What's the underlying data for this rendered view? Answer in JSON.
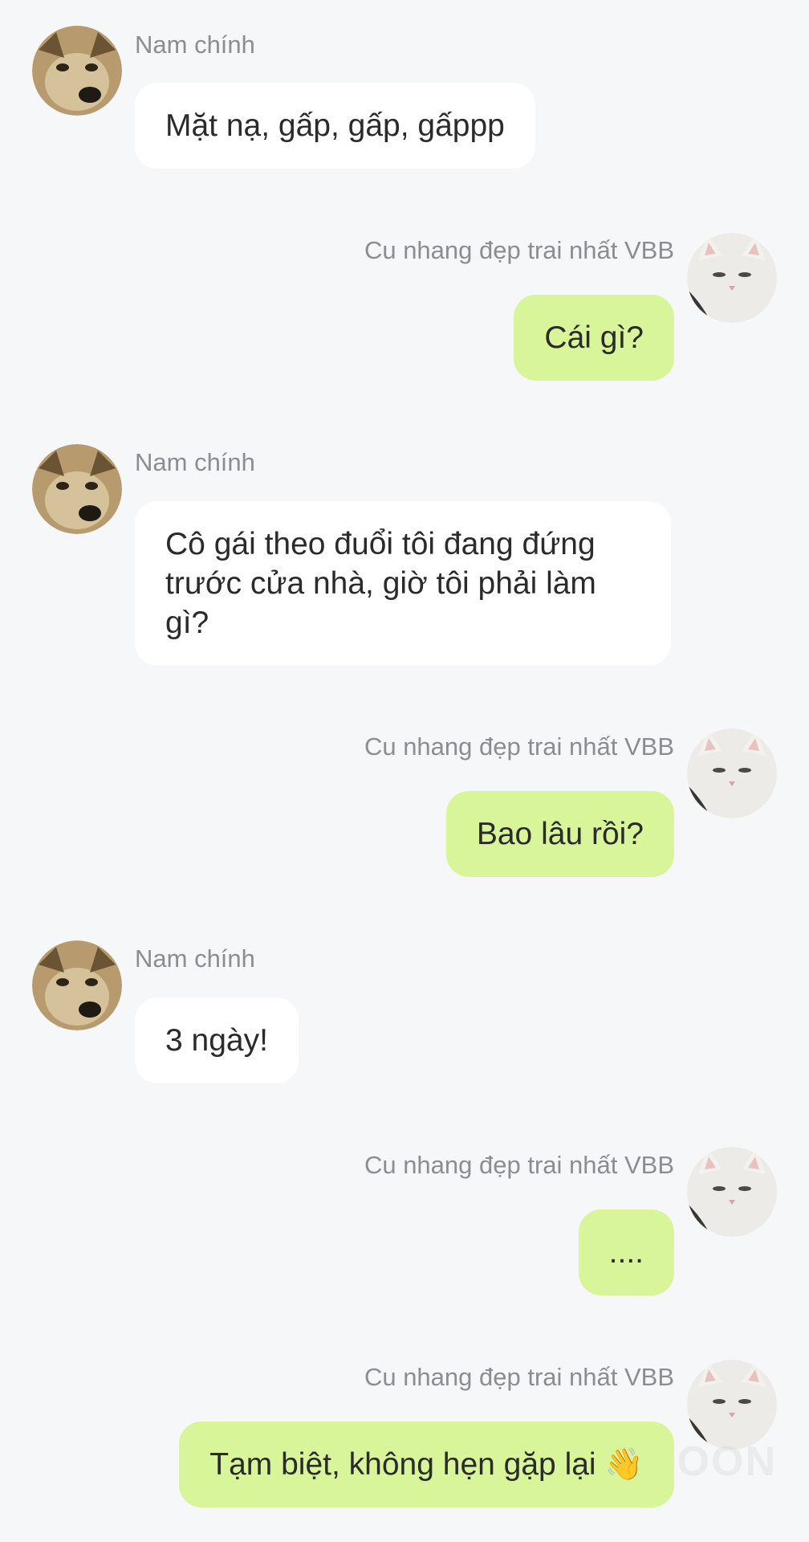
{
  "contacts": {
    "left_name": "Nam chính",
    "right_name": "Cu nhang đẹp trai nhất VBB"
  },
  "messages": [
    {
      "side": "left",
      "sender": "Nam chính",
      "text": "Mặt nạ, gấp, gấp, gấppp"
    },
    {
      "side": "right",
      "sender": "Cu nhang đẹp trai nhất VBB",
      "text": "Cái gì?"
    },
    {
      "side": "left",
      "sender": "Nam chính",
      "text": "Cô gái theo đuổi tôi đang đứng trước cửa nhà, giờ tôi phải làm gì?"
    },
    {
      "side": "right",
      "sender": "Cu nhang đẹp trai nhất VBB",
      "text": "Bao lâu rồi?"
    },
    {
      "side": "left",
      "sender": "Nam chính",
      "text": "3 ngày!"
    },
    {
      "side": "right",
      "sender": "Cu nhang đẹp trai nhất VBB",
      "text": "...."
    },
    {
      "side": "right",
      "sender": "Cu nhang đẹp trai nhất VBB",
      "text": "Tạm biệt, không hẹn gặp lại 👋"
    }
  ],
  "watermark": "OON",
  "colors": {
    "background": "#f6f7f9",
    "incoming_bubble": "#ffffff",
    "outgoing_bubble": "#d8f59a",
    "name_text": "#8a8d91",
    "message_text": "#2b2b2b"
  }
}
